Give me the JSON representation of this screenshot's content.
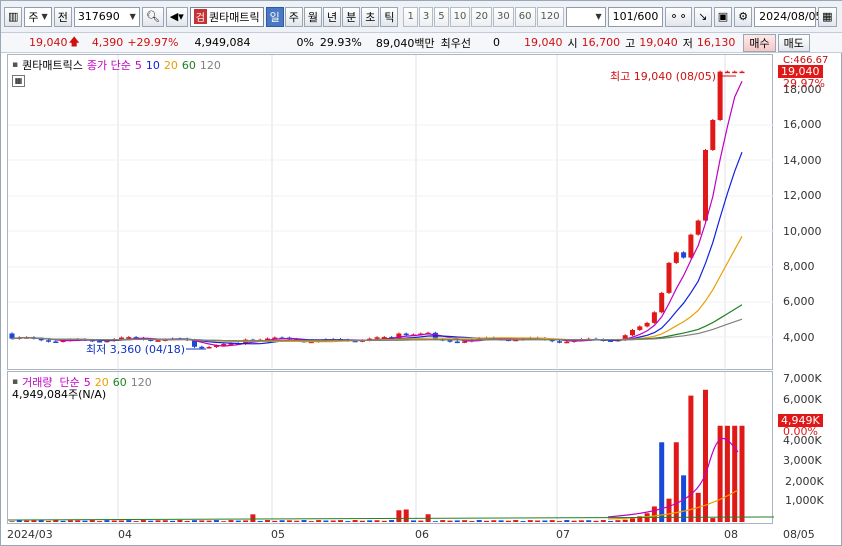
{
  "toolbar": {
    "market": "주",
    "prev": "전",
    "code": "317690",
    "name_badge": "검",
    "name": "퀀타매트릭",
    "periods": [
      "일",
      "주",
      "월",
      "년",
      "분",
      "초",
      "틱"
    ],
    "numbers": [
      "1",
      "3",
      "5",
      "10",
      "20",
      "30",
      "60",
      "120"
    ],
    "count": "101",
    "count_total": "/600",
    "date": "2024/08/05"
  },
  "info": {
    "price": "19,040",
    "change": "4,390",
    "change_pct": "+29.97%",
    "volume": "4,949,084",
    "ratio": "0%",
    "ratio_pct": "29.93%",
    "amount": "89,040백만",
    "best_label": "최우선",
    "best_value": "0",
    "close_val": "19,040",
    "open_label": "시",
    "open_val": "16,700",
    "high_label": "고",
    "high_val": "19,040",
    "low_label": "저",
    "low_val": "16,130",
    "buy": "매수",
    "sell": "매도"
  },
  "price_panel": {
    "legend_name": "퀀타매트릭스",
    "legend_type": "종가 단순",
    "legend_periods": [
      "5",
      "10",
      "20",
      "60",
      "120"
    ],
    "legend_colors": [
      "#c000c0",
      "#1020e0",
      "#e8a000",
      "#208020",
      "#808080"
    ],
    "high_note": "최고 19,040 (08/05)",
    "low_note": "최저 3,360 (04/18)",
    "axis_ticks": [
      "18,000",
      "16,000",
      "14,000",
      "12,000",
      "10,000",
      "8,000",
      "6,000",
      "4,000"
    ],
    "tag_price": "19,040",
    "tag_pct": "29.97%",
    "tag_c": "C:466.67"
  },
  "volume_panel": {
    "legend_name": "거래량",
    "legend_type": "단순",
    "legend_periods": [
      "5",
      "20",
      "60",
      "120"
    ],
    "legend_colors": [
      "#c000c0",
      "#e8a000",
      "#208020",
      "#808080"
    ],
    "volume_text": "4,949,084주(N/A)",
    "axis_ticks": [
      "7,000K",
      "6,000K",
      "5,000K",
      "4,000K",
      "3,000K",
      "2,000K",
      "1,000K"
    ],
    "tag_volume": "4,949K",
    "tag_pct": "0.00%"
  },
  "x_labels": [
    "2024/03",
    "04",
    "05",
    "06",
    "07",
    "08",
    "08/05"
  ],
  "colors": {
    "up": "#e01818",
    "down": "#1a48d8",
    "accent": "#4a78c2"
  }
}
